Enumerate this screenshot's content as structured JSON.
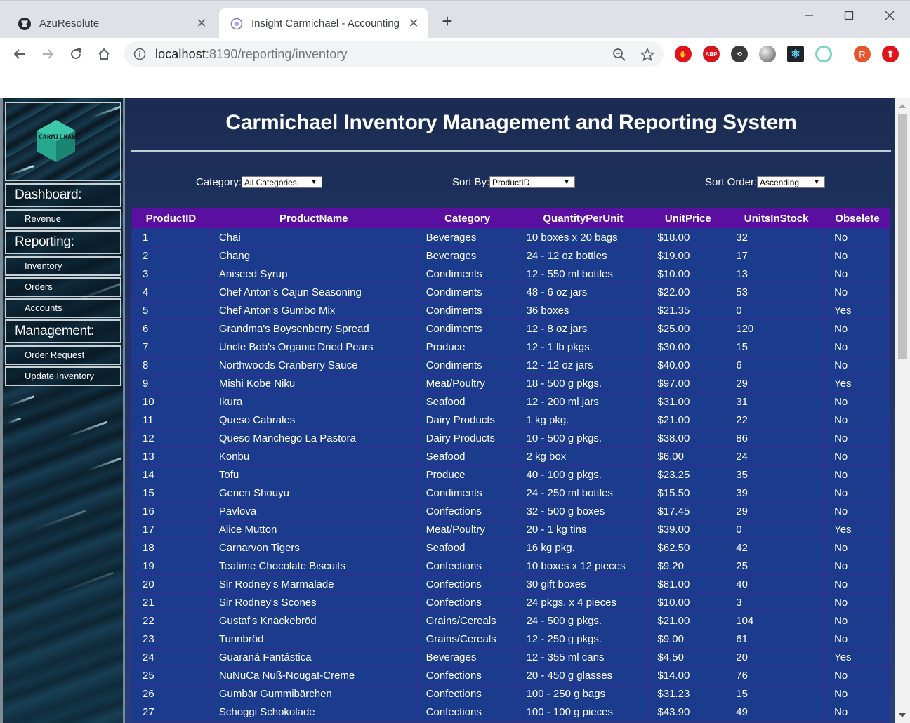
{
  "browser": {
    "tabs": [
      {
        "title": "AzuResolute",
        "icon": "github-icon"
      },
      {
        "title": "Insight Carmichael - Accounting",
        "icon": "app-icon"
      }
    ],
    "url_host": "localhost",
    "url_rest": ":8190/reporting/inventory",
    "profile_initial": "R",
    "ext_abp": "ABP"
  },
  "sidebar": {
    "logo_text": "CARMICHAEL",
    "sections": [
      {
        "header": "Dashboard:",
        "items": [
          "Revenue"
        ]
      },
      {
        "header": "Reporting:",
        "items": [
          "Inventory",
          "Orders",
          "Accounts"
        ]
      },
      {
        "header": "Management:",
        "items": [
          "Order Request",
          "Update Inventory"
        ]
      }
    ]
  },
  "main": {
    "title": "Carmichael Inventory Management and Reporting System",
    "filters": {
      "category_label": "Category:",
      "category_value": "All Categories",
      "sort_by_label": "Sort By:",
      "sort_by_value": "ProductID",
      "sort_order_label": "Sort Order:",
      "sort_order_value": "Ascending"
    }
  },
  "table": {
    "headers": [
      "ProductID",
      "ProductName",
      "Category",
      "QuantityPerUnit",
      "UnitPrice",
      "UnitsInStock",
      "Obselete"
    ],
    "rows": [
      [
        "1",
        "Chai",
        "Beverages",
        "10 boxes x 20 bags",
        "$18.00",
        "32",
        "No"
      ],
      [
        "2",
        "Chang",
        "Beverages",
        "24 - 12 oz bottles",
        "$19.00",
        "17",
        "No"
      ],
      [
        "3",
        "Aniseed Syrup",
        "Condiments",
        "12 - 550 ml bottles",
        "$10.00",
        "13",
        "No"
      ],
      [
        "4",
        "Chef Anton's Cajun Seasoning",
        "Condiments",
        "48 - 6 oz jars",
        "$22.00",
        "53",
        "No"
      ],
      [
        "5",
        "Chef Anton's Gumbo Mix",
        "Condiments",
        "36 boxes",
        "$21.35",
        "0",
        "Yes"
      ],
      [
        "6",
        "Grandma's Boysenberry Spread",
        "Condiments",
        "12 - 8 oz jars",
        "$25.00",
        "120",
        "No"
      ],
      [
        "7",
        "Uncle Bob's Organic Dried Pears",
        "Produce",
        "12 - 1 lb pkgs.",
        "$30.00",
        "15",
        "No"
      ],
      [
        "8",
        "Northwoods Cranberry Sauce",
        "Condiments",
        "12 - 12 oz jars",
        "$40.00",
        "6",
        "No"
      ],
      [
        "9",
        "Mishi Kobe Niku",
        "Meat/Poultry",
        "18 - 500 g pkgs.",
        "$97.00",
        "29",
        "Yes"
      ],
      [
        "10",
        "Ikura",
        "Seafood",
        "12 - 200 ml jars",
        "$31.00",
        "31",
        "No"
      ],
      [
        "11",
        "Queso Cabrales",
        "Dairy Products",
        "1 kg pkg.",
        "$21.00",
        "22",
        "No"
      ],
      [
        "12",
        "Queso Manchego La Pastora",
        "Dairy Products",
        "10 - 500 g pkgs.",
        "$38.00",
        "86",
        "No"
      ],
      [
        "13",
        "Konbu",
        "Seafood",
        "2 kg box",
        "$6.00",
        "24",
        "No"
      ],
      [
        "14",
        "Tofu",
        "Produce",
        "40 - 100 g pkgs.",
        "$23.25",
        "35",
        "No"
      ],
      [
        "15",
        "Genen Shouyu",
        "Condiments",
        "24 - 250 ml bottles",
        "$15.50",
        "39",
        "No"
      ],
      [
        "16",
        "Pavlova",
        "Confections",
        "32 - 500 g boxes",
        "$17.45",
        "29",
        "No"
      ],
      [
        "17",
        "Alice Mutton",
        "Meat/Poultry",
        "20 - 1 kg tins",
        "$39.00",
        "0",
        "Yes"
      ],
      [
        "18",
        "Carnarvon Tigers",
        "Seafood",
        "16 kg pkg.",
        "$62.50",
        "42",
        "No"
      ],
      [
        "19",
        "Teatime Chocolate Biscuits",
        "Confections",
        "10 boxes x 12 pieces",
        "$9.20",
        "25",
        "No"
      ],
      [
        "20",
        "Sir Rodney's Marmalade",
        "Confections",
        "30 gift boxes",
        "$81.00",
        "40",
        "No"
      ],
      [
        "21",
        "Sir Rodney's Scones",
        "Confections",
        "24 pkgs. x 4 pieces",
        "$10.00",
        "3",
        "No"
      ],
      [
        "22",
        "Gustaf's Knäckebröd",
        "Grains/Cereals",
        "24 - 500 g pkgs.",
        "$21.00",
        "104",
        "No"
      ],
      [
        "23",
        "Tunnbröd",
        "Grains/Cereals",
        "12 - 250 g pkgs.",
        "$9.00",
        "61",
        "No"
      ],
      [
        "24",
        "Guaraná Fantástica",
        "Beverages",
        "12 - 355 ml cans",
        "$4.50",
        "20",
        "Yes"
      ],
      [
        "25",
        "NuNuCa Nuß-Nougat-Creme",
        "Confections",
        "20 - 450 g glasses",
        "$14.00",
        "76",
        "No"
      ],
      [
        "26",
        "Gumbär Gummibärchen",
        "Confections",
        "100 - 250 g bags",
        "$31.23",
        "15",
        "No"
      ],
      [
        "27",
        "Schoggi Schokolade",
        "Confections",
        "100 - 100 g pieces",
        "$43.90",
        "49",
        "No"
      ]
    ]
  }
}
